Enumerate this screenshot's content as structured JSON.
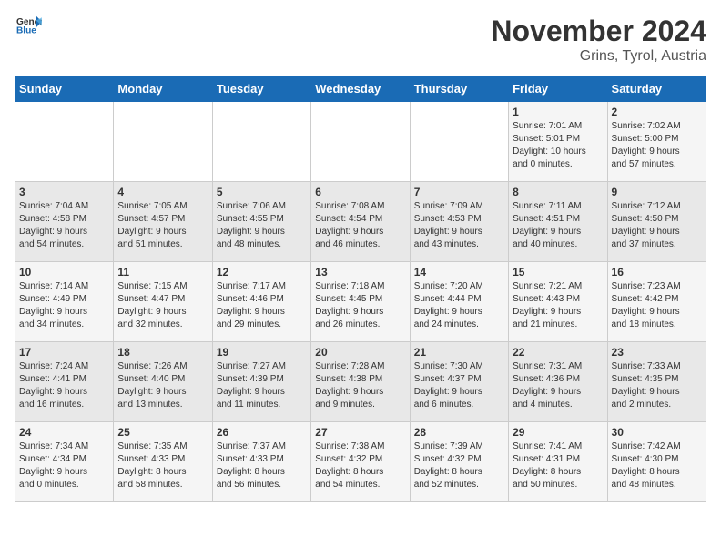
{
  "logo": {
    "general": "General",
    "blue": "Blue"
  },
  "title": {
    "month_year": "November 2024",
    "location": "Grins, Tyrol, Austria"
  },
  "headers": [
    "Sunday",
    "Monday",
    "Tuesday",
    "Wednesday",
    "Thursday",
    "Friday",
    "Saturday"
  ],
  "weeks": [
    [
      {
        "day": "",
        "detail": ""
      },
      {
        "day": "",
        "detail": ""
      },
      {
        "day": "",
        "detail": ""
      },
      {
        "day": "",
        "detail": ""
      },
      {
        "day": "",
        "detail": ""
      },
      {
        "day": "1",
        "detail": "Sunrise: 7:01 AM\nSunset: 5:01 PM\nDaylight: 10 hours\nand 0 minutes."
      },
      {
        "day": "2",
        "detail": "Sunrise: 7:02 AM\nSunset: 5:00 PM\nDaylight: 9 hours\nand 57 minutes."
      }
    ],
    [
      {
        "day": "3",
        "detail": "Sunrise: 7:04 AM\nSunset: 4:58 PM\nDaylight: 9 hours\nand 54 minutes."
      },
      {
        "day": "4",
        "detail": "Sunrise: 7:05 AM\nSunset: 4:57 PM\nDaylight: 9 hours\nand 51 minutes."
      },
      {
        "day": "5",
        "detail": "Sunrise: 7:06 AM\nSunset: 4:55 PM\nDaylight: 9 hours\nand 48 minutes."
      },
      {
        "day": "6",
        "detail": "Sunrise: 7:08 AM\nSunset: 4:54 PM\nDaylight: 9 hours\nand 46 minutes."
      },
      {
        "day": "7",
        "detail": "Sunrise: 7:09 AM\nSunset: 4:53 PM\nDaylight: 9 hours\nand 43 minutes."
      },
      {
        "day": "8",
        "detail": "Sunrise: 7:11 AM\nSunset: 4:51 PM\nDaylight: 9 hours\nand 40 minutes."
      },
      {
        "day": "9",
        "detail": "Sunrise: 7:12 AM\nSunset: 4:50 PM\nDaylight: 9 hours\nand 37 minutes."
      }
    ],
    [
      {
        "day": "10",
        "detail": "Sunrise: 7:14 AM\nSunset: 4:49 PM\nDaylight: 9 hours\nand 34 minutes."
      },
      {
        "day": "11",
        "detail": "Sunrise: 7:15 AM\nSunset: 4:47 PM\nDaylight: 9 hours\nand 32 minutes."
      },
      {
        "day": "12",
        "detail": "Sunrise: 7:17 AM\nSunset: 4:46 PM\nDaylight: 9 hours\nand 29 minutes."
      },
      {
        "day": "13",
        "detail": "Sunrise: 7:18 AM\nSunset: 4:45 PM\nDaylight: 9 hours\nand 26 minutes."
      },
      {
        "day": "14",
        "detail": "Sunrise: 7:20 AM\nSunset: 4:44 PM\nDaylight: 9 hours\nand 24 minutes."
      },
      {
        "day": "15",
        "detail": "Sunrise: 7:21 AM\nSunset: 4:43 PM\nDaylight: 9 hours\nand 21 minutes."
      },
      {
        "day": "16",
        "detail": "Sunrise: 7:23 AM\nSunset: 4:42 PM\nDaylight: 9 hours\nand 18 minutes."
      }
    ],
    [
      {
        "day": "17",
        "detail": "Sunrise: 7:24 AM\nSunset: 4:41 PM\nDaylight: 9 hours\nand 16 minutes."
      },
      {
        "day": "18",
        "detail": "Sunrise: 7:26 AM\nSunset: 4:40 PM\nDaylight: 9 hours\nand 13 minutes."
      },
      {
        "day": "19",
        "detail": "Sunrise: 7:27 AM\nSunset: 4:39 PM\nDaylight: 9 hours\nand 11 minutes."
      },
      {
        "day": "20",
        "detail": "Sunrise: 7:28 AM\nSunset: 4:38 PM\nDaylight: 9 hours\nand 9 minutes."
      },
      {
        "day": "21",
        "detail": "Sunrise: 7:30 AM\nSunset: 4:37 PM\nDaylight: 9 hours\nand 6 minutes."
      },
      {
        "day": "22",
        "detail": "Sunrise: 7:31 AM\nSunset: 4:36 PM\nDaylight: 9 hours\nand 4 minutes."
      },
      {
        "day": "23",
        "detail": "Sunrise: 7:33 AM\nSunset: 4:35 PM\nDaylight: 9 hours\nand 2 minutes."
      }
    ],
    [
      {
        "day": "24",
        "detail": "Sunrise: 7:34 AM\nSunset: 4:34 PM\nDaylight: 9 hours\nand 0 minutes."
      },
      {
        "day": "25",
        "detail": "Sunrise: 7:35 AM\nSunset: 4:33 PM\nDaylight: 8 hours\nand 58 minutes."
      },
      {
        "day": "26",
        "detail": "Sunrise: 7:37 AM\nSunset: 4:33 PM\nDaylight: 8 hours\nand 56 minutes."
      },
      {
        "day": "27",
        "detail": "Sunrise: 7:38 AM\nSunset: 4:32 PM\nDaylight: 8 hours\nand 54 minutes."
      },
      {
        "day": "28",
        "detail": "Sunrise: 7:39 AM\nSunset: 4:32 PM\nDaylight: 8 hours\nand 52 minutes."
      },
      {
        "day": "29",
        "detail": "Sunrise: 7:41 AM\nSunset: 4:31 PM\nDaylight: 8 hours\nand 50 minutes."
      },
      {
        "day": "30",
        "detail": "Sunrise: 7:42 AM\nSunset: 4:30 PM\nDaylight: 8 hours\nand 48 minutes."
      }
    ]
  ]
}
